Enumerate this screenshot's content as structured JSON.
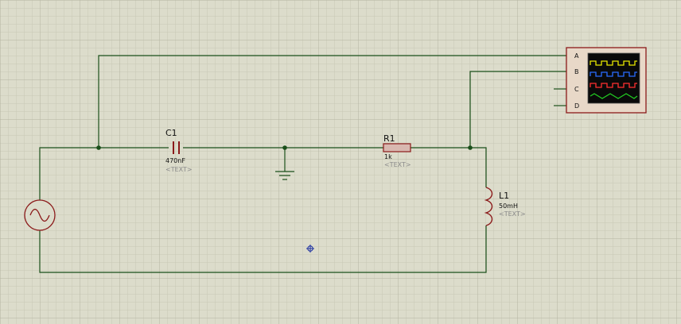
{
  "components": {
    "c1": {
      "ref": "C1",
      "value": "470nF",
      "text": "<TEXT>"
    },
    "r1": {
      "ref": "R1",
      "value": "1k",
      "text": "<TEXT>"
    },
    "l1": {
      "ref": "L1",
      "value": "50mH",
      "text": "<TEXT>"
    }
  },
  "oscilloscope": {
    "channels": [
      "A",
      "B",
      "C",
      "D"
    ],
    "trace_colors": [
      "#e8e800",
      "#2a6cff",
      "#ff3030",
      "#22cc22"
    ]
  },
  "colors": {
    "background": "#dcdccb",
    "grid_minor": "#c8c8b6",
    "grid_major": "#b4b4a2",
    "wire": "#1a4f1a",
    "component_body": "#8b1a1a",
    "cursor": "#1a2ea0"
  }
}
